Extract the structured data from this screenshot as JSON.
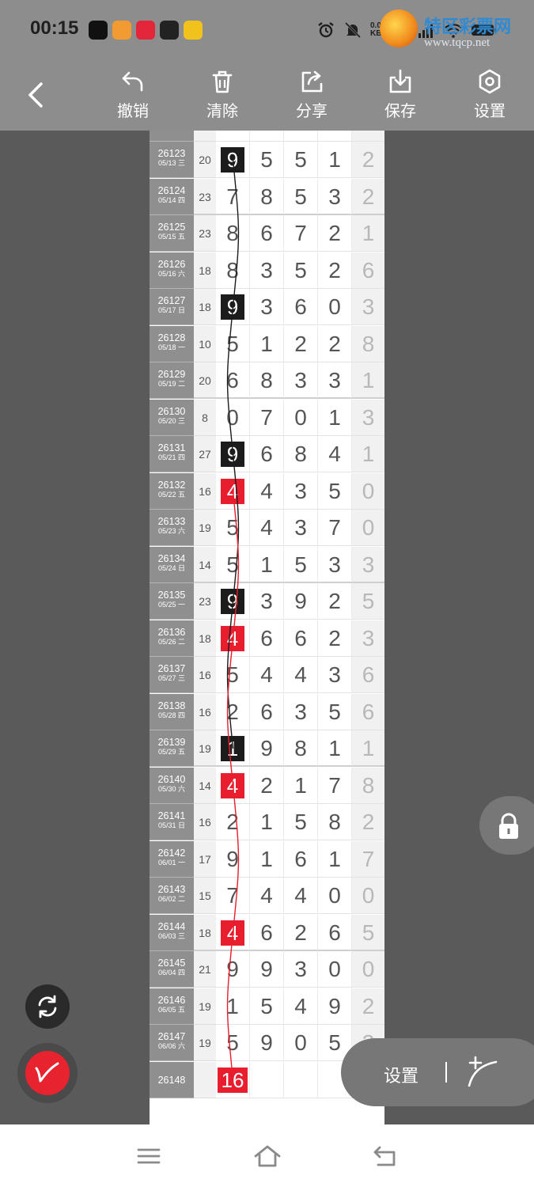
{
  "status_bar": {
    "time": "00:15",
    "net_speed_value": "0.01",
    "net_speed_unit": "KB/s",
    "net_type": "5G"
  },
  "watermark": {
    "title": "特区彩票网",
    "url": "www.tqcp.net"
  },
  "toolbar": {
    "undo_label": "撤销",
    "clear_label": "清除",
    "share_label": "分享",
    "save_label": "保存",
    "settings_label": "设置"
  },
  "rows": [
    {
      "issue": "26123",
      "date": "05/13 三",
      "sum": "20",
      "digits": [
        "9",
        "5",
        "5",
        "1"
      ],
      "last": "2",
      "mark": {
        "col": 0,
        "color": "black"
      }
    },
    {
      "issue": "26124",
      "date": "05/14 四",
      "sum": "23",
      "digits": [
        "7",
        "8",
        "5",
        "3"
      ],
      "last": "2",
      "mark": null
    },
    {
      "issue": "26125",
      "date": "05/15 五",
      "sum": "23",
      "digits": [
        "8",
        "6",
        "7",
        "2"
      ],
      "last": "1",
      "mark": null
    },
    {
      "issue": "26126",
      "date": "05/16 六",
      "sum": "18",
      "digits": [
        "8",
        "3",
        "5",
        "2"
      ],
      "last": "6",
      "mark": null
    },
    {
      "issue": "26127",
      "date": "05/17 日",
      "sum": "18",
      "digits": [
        "9",
        "3",
        "6",
        "0"
      ],
      "last": "3",
      "mark": {
        "col": 0,
        "color": "black"
      }
    },
    {
      "issue": "26128",
      "date": "05/18 一",
      "sum": "10",
      "digits": [
        "5",
        "1",
        "2",
        "2"
      ],
      "last": "8",
      "mark": null
    },
    {
      "issue": "26129",
      "date": "05/19 二",
      "sum": "20",
      "digits": [
        "6",
        "8",
        "3",
        "3"
      ],
      "last": "1",
      "mark": null
    },
    {
      "issue": "26130",
      "date": "05/20 三",
      "sum": "8",
      "digits": [
        "0",
        "7",
        "0",
        "1"
      ],
      "last": "3",
      "mark": null
    },
    {
      "issue": "26131",
      "date": "05/21 四",
      "sum": "27",
      "digits": [
        "9",
        "6",
        "8",
        "4"
      ],
      "last": "1",
      "mark": {
        "col": 0,
        "color": "black"
      }
    },
    {
      "issue": "26132",
      "date": "05/22 五",
      "sum": "16",
      "digits": [
        "4",
        "4",
        "3",
        "5"
      ],
      "last": "0",
      "mark": {
        "col": 0,
        "color": "red"
      }
    },
    {
      "issue": "26133",
      "date": "05/23 六",
      "sum": "19",
      "digits": [
        "5",
        "4",
        "3",
        "7"
      ],
      "last": "0",
      "mark": null
    },
    {
      "issue": "26134",
      "date": "05/24 日",
      "sum": "14",
      "digits": [
        "5",
        "1",
        "5",
        "3"
      ],
      "last": "3",
      "mark": null
    },
    {
      "issue": "26135",
      "date": "05/25 一",
      "sum": "23",
      "digits": [
        "9",
        "3",
        "9",
        "2"
      ],
      "last": "5",
      "mark": {
        "col": 0,
        "color": "black"
      }
    },
    {
      "issue": "26136",
      "date": "05/26 二",
      "sum": "18",
      "digits": [
        "4",
        "6",
        "6",
        "2"
      ],
      "last": "3",
      "mark": {
        "col": 0,
        "color": "red"
      }
    },
    {
      "issue": "26137",
      "date": "05/27 三",
      "sum": "16",
      "digits": [
        "5",
        "4",
        "4",
        "3"
      ],
      "last": "6",
      "mark": null
    },
    {
      "issue": "26138",
      "date": "05/28 四",
      "sum": "16",
      "digits": [
        "2",
        "6",
        "3",
        "5"
      ],
      "last": "6",
      "mark": null
    },
    {
      "issue": "26139",
      "date": "05/29 五",
      "sum": "19",
      "digits": [
        "1",
        "9",
        "8",
        "1"
      ],
      "last": "1",
      "mark": {
        "col": 0,
        "color": "black"
      }
    },
    {
      "issue": "26140",
      "date": "05/30 六",
      "sum": "14",
      "digits": [
        "4",
        "2",
        "1",
        "7"
      ],
      "last": "8",
      "mark": {
        "col": 0,
        "color": "red"
      }
    },
    {
      "issue": "26141",
      "date": "05/31 日",
      "sum": "16",
      "digits": [
        "2",
        "1",
        "5",
        "8"
      ],
      "last": "2",
      "mark": null
    },
    {
      "issue": "26142",
      "date": "06/01 一",
      "sum": "17",
      "digits": [
        "9",
        "1",
        "6",
        "1"
      ],
      "last": "7",
      "mark": null
    },
    {
      "issue": "26143",
      "date": "06/02 二",
      "sum": "15",
      "digits": [
        "7",
        "4",
        "4",
        "0"
      ],
      "last": "0",
      "mark": null
    },
    {
      "issue": "26144",
      "date": "06/03 三",
      "sum": "18",
      "digits": [
        "4",
        "6",
        "2",
        "6"
      ],
      "last": "5",
      "mark": {
        "col": 0,
        "color": "red"
      }
    },
    {
      "issue": "26145",
      "date": "06/04 四",
      "sum": "21",
      "digits": [
        "9",
        "9",
        "3",
        "0"
      ],
      "last": "0",
      "mark": null
    },
    {
      "issue": "26146",
      "date": "06/05 五",
      "sum": "19",
      "digits": [
        "1",
        "5",
        "4",
        "9"
      ],
      "last": "2",
      "mark": null
    },
    {
      "issue": "26147",
      "date": "06/06 六",
      "sum": "19",
      "digits": [
        "5",
        "9",
        "0",
        "5"
      ],
      "last": "3",
      "mark": null
    },
    {
      "issue": "26148",
      "date": "",
      "sum": "",
      "digits": [
        "16",
        "",
        "",
        ""
      ],
      "last": "",
      "mark": {
        "col": 0,
        "color": "red"
      }
    }
  ],
  "floating": {
    "settings_label": "设置"
  },
  "colors": {
    "accent_red": "#e81d2d",
    "mark_black": "#1c1c1c",
    "toolbar_bg": "#8d8d8d"
  },
  "icons": {
    "back": "chevron-left-icon",
    "undo": "undo-icon",
    "clear": "trash-icon",
    "share": "share-icon",
    "save": "download-icon",
    "settings": "hexagon-gear-icon",
    "lock": "lock-icon",
    "rotate": "rotate-icon",
    "draw": "pen-icon",
    "nav_menu": "menu-icon",
    "nav_home": "home-icon",
    "nav_back": "return-icon"
  }
}
